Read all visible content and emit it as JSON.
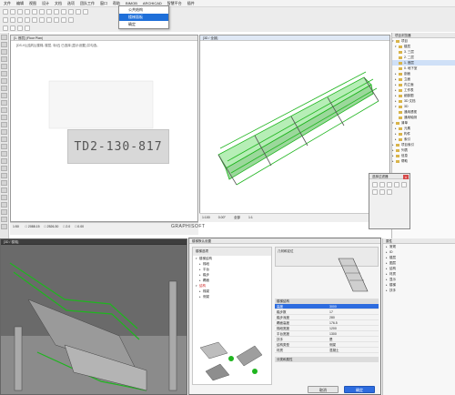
{
  "menubar": {
    "items": [
      "文件",
      "编辑",
      "视图",
      "设计",
      "文档",
      "选项",
      "团队工作",
      "窗口",
      "帮助",
      "BIMOB",
      "ARCHICAD",
      "智慧平台",
      "插件"
    ]
  },
  "menu_popup": {
    "items": [
      "公共结构",
      "楼梯面板",
      "确定"
    ]
  },
  "left_window": {
    "title": "[1. 首层] (Floor Plan)",
    "note_text": "[DS-H] [结构] [楼梯, 楼层, 标记] 已选择 [显示设置] 并勾选。",
    "stair_label": "TD2-130-817"
  },
  "right_window": {
    "title": "[3D / 全部]"
  },
  "status_left": {
    "zoom": "1:50",
    "items": [
      "□ 2088.15",
      "□ 2526.30",
      "□ 2.0",
      "□ 0.00"
    ]
  },
  "status_right": {
    "items": [
      "1:100",
      "0.00°",
      "全部",
      "1:1"
    ]
  },
  "graphisoft_label": "GRAPHISOFT",
  "navigator": {
    "title": "项目浏览器",
    "items": [
      "项目",
      "楼层",
      "3. 三层",
      "2. 二层",
      "1. 首层",
      "0. 地下室",
      "剖面",
      "立面",
      "内立面",
      "工作表",
      "细部图",
      "3D 文档",
      "3D",
      "通用透视",
      "通用轴测",
      "清单",
      "元素",
      "构件",
      "索引",
      "项目索引",
      "列表",
      "信息",
      "帮助"
    ]
  },
  "float_palette": {
    "title": "选择过滤器",
    "close": "x"
  },
  "bottom_3d_title": "[3D / 楼梯]",
  "dialog": {
    "title": "楼梯默认设置",
    "tree_title": "楼梯选项",
    "tree_items": [
      "楼梯结构",
      "梯段",
      "平台",
      "踏步",
      "踢面",
      "结构",
      "梯梁",
      "侧梁"
    ],
    "sections": [
      "几何和定位",
      "楼梯结构",
      "分类和属性"
    ],
    "prop_rows": [
      [
        "高度",
        "3000"
      ],
      [
        "踏步数",
        "17"
      ],
      [
        "踏步深度",
        "280"
      ],
      [
        "踢面高度",
        "176.5"
      ],
      [
        "梯段宽度",
        "1200"
      ],
      [
        "平台宽度",
        "1300"
      ],
      [
        "扶手",
        "是"
      ],
      [
        "结构类型",
        "侧梁"
      ],
      [
        "材质",
        "混凝土"
      ]
    ],
    "selected_prop": "高度",
    "cancel_label": "取消",
    "ok_label": "确定"
  },
  "right_bottom_panel": {
    "title": "属性",
    "items": [
      "常规",
      "ID",
      "楼层",
      "图层",
      "结构",
      "材质",
      "显示",
      "楼梯",
      "扶手"
    ]
  },
  "colors": {
    "accent": "#2d6cdf",
    "stair_green": "#1fb51f",
    "alert": "#d64a4a"
  }
}
